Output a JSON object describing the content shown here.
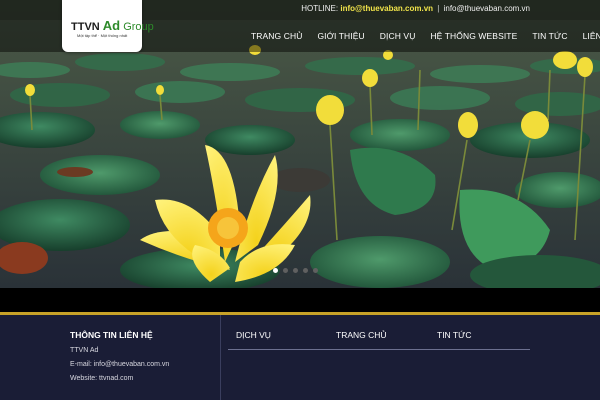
{
  "header": {
    "hotline_label": "HOTLINE:",
    "hotline_email": "info@thuevaban.com.vn",
    "separator": "|",
    "email": "info@thuevaban.com.vn"
  },
  "logo": {
    "brand_prefix": "TTVN",
    "brand_ad": "Ad",
    "brand_group": "Group",
    "tagline": "Một tập thể · Một thống nhất"
  },
  "nav": {
    "items": [
      "TRANG CHỦ",
      "GIỚI THIỆU",
      "DỊCH VỤ",
      "HỆ THỐNG WEBSITE",
      "TIN TỨC",
      "LIÊN HỆ"
    ]
  },
  "slider": {
    "slide_count": 5,
    "active_index": 0
  },
  "footer": {
    "contact_title": "THÔNG TIN LIÊN HỆ",
    "company": "TTVN Ad",
    "email_line": "E-mail: info@thuevaban.com.vn",
    "website_line": "Website: ttvnad.com",
    "col_services": "DỊCH VỤ",
    "col_home": "TRANG CHỦ",
    "col_news": "TIN TỨC"
  },
  "colors": {
    "accent_yellow": "#f1e44a",
    "footer_bg": "#1a1d36",
    "footer_line": "#c8a228",
    "logo_green": "#2d8a2a"
  }
}
